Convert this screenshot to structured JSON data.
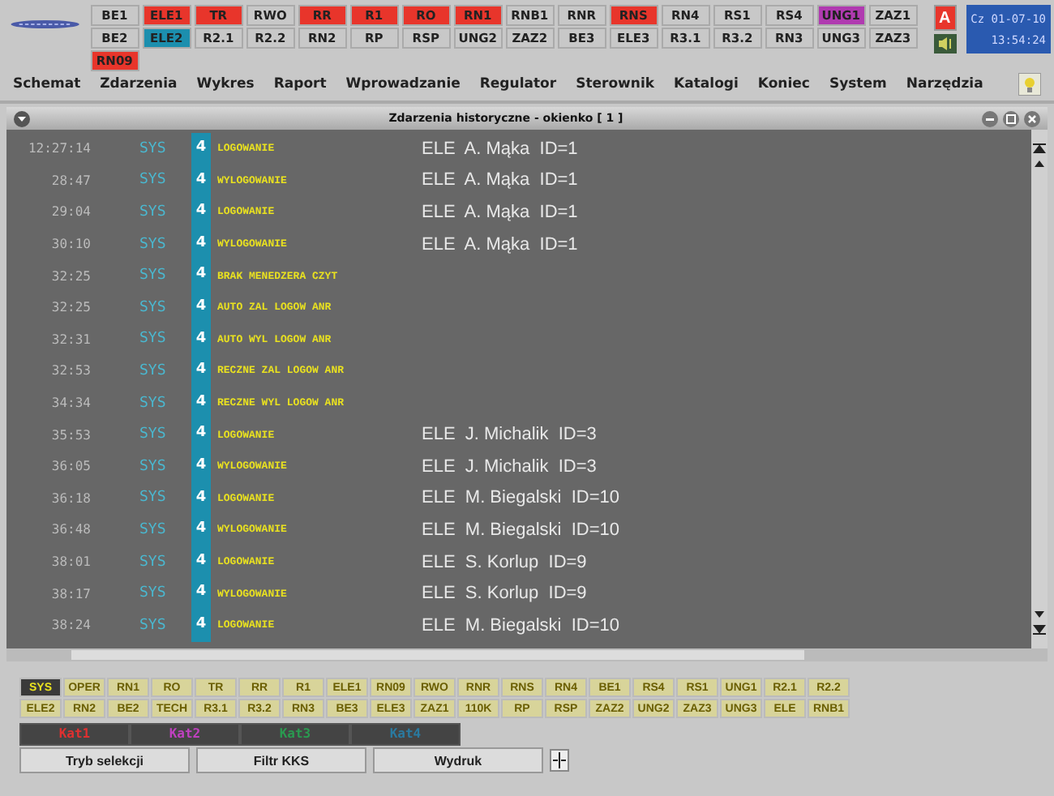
{
  "top_bar": {
    "codes": [
      [
        {
          "label": "BE1",
          "color": "#c8c8c8"
        },
        {
          "label": "BE2",
          "color": "#c8c8c8"
        },
        {
          "label": "RN09",
          "color": "#e8352b"
        }
      ],
      [
        {
          "label": "ELE1",
          "color": "#e8352b"
        },
        {
          "label": "ELE2",
          "color": "#1c8fae"
        }
      ],
      [
        {
          "label": "TR",
          "color": "#e8352b"
        },
        {
          "label": "R2.1",
          "color": "#c8c8c8"
        }
      ],
      [
        {
          "label": "RWO",
          "color": "#c8c8c8"
        },
        {
          "label": "R2.2",
          "color": "#c8c8c8"
        }
      ],
      [
        {
          "label": "RR",
          "color": "#e8352b"
        },
        {
          "label": "RN2",
          "color": "#c8c8c8"
        }
      ],
      [
        {
          "label": "R1",
          "color": "#e8352b"
        },
        {
          "label": "RP",
          "color": "#c8c8c8"
        }
      ],
      [
        {
          "label": "RO",
          "color": "#e8352b"
        },
        {
          "label": "RSP",
          "color": "#c8c8c8"
        }
      ],
      [
        {
          "label": "RN1",
          "color": "#e8352b"
        },
        {
          "label": "UNG2",
          "color": "#c8c8c8"
        }
      ],
      [
        {
          "label": "RNB1",
          "color": "#c8c8c8"
        },
        {
          "label": "ZAZ2",
          "color": "#c8c8c8"
        }
      ],
      [
        {
          "label": "RNR",
          "color": "#c8c8c8"
        },
        {
          "label": "BE3",
          "color": "#c8c8c8"
        }
      ],
      [
        {
          "label": "RNS",
          "color": "#e8352b"
        },
        {
          "label": "ELE3",
          "color": "#c8c8c8"
        }
      ],
      [
        {
          "label": "RN4",
          "color": "#c8c8c8"
        },
        {
          "label": "R3.1",
          "color": "#c8c8c8"
        }
      ],
      [
        {
          "label": "RS1",
          "color": "#c8c8c8"
        },
        {
          "label": "R3.2",
          "color": "#c8c8c8"
        }
      ],
      [
        {
          "label": "RS4",
          "color": "#c8c8c8"
        },
        {
          "label": "RN3",
          "color": "#c8c8c8"
        }
      ],
      [
        {
          "label": "UNG1",
          "color": "#b03ab0"
        },
        {
          "label": "UNG3",
          "color": "#c8c8c8"
        }
      ],
      [
        {
          "label": "ZAZ1",
          "color": "#c8c8c8"
        },
        {
          "label": "ZAZ3",
          "color": "#c8c8c8"
        }
      ]
    ],
    "alarm_button": "A",
    "date": "Cz 01-07-10",
    "time": "13:54:24"
  },
  "menu": [
    "Schemat",
    "Zdarzenia",
    "Wykres",
    "Raport",
    "Wprowadzanie",
    "Regulator",
    "Sterownik",
    "Katalogi",
    "Koniec",
    "System",
    "Narzędzia"
  ],
  "window": {
    "title": "Zdarzenia historyczne - okienko [ 1 ]"
  },
  "events": [
    {
      "time": "12:27:14",
      "source": "SYS",
      "priority": "4",
      "message": "LOGOWANIE",
      "user": "ELE  A. Mąka  ID=1"
    },
    {
      "time": "28:47",
      "source": "SYS",
      "priority": "4",
      "message": "WYLOGOWANIE",
      "user": "ELE  A. Mąka  ID=1"
    },
    {
      "time": "29:04",
      "source": "SYS",
      "priority": "4",
      "message": "LOGOWANIE",
      "user": "ELE  A. Mąka  ID=1"
    },
    {
      "time": "30:10",
      "source": "SYS",
      "priority": "4",
      "message": "WYLOGOWANIE",
      "user": "ELE  A. Mąka  ID=1"
    },
    {
      "time": "32:25",
      "source": "SYS",
      "priority": "4",
      "message": "BRAK MENEDZERA CZYT"
    },
    {
      "time": "32:25",
      "source": "SYS",
      "priority": "4",
      "message": "AUTO ZAL LOGOW ANR"
    },
    {
      "time": "32:31",
      "source": "SYS",
      "priority": "4",
      "message": "AUTO WYL LOGOW ANR"
    },
    {
      "time": "32:53",
      "source": "SYS",
      "priority": "4",
      "message": "RECZNE ZAL LOGOW ANR"
    },
    {
      "time": "34:34",
      "source": "SYS",
      "priority": "4",
      "message": "RECZNE WYL LOGOW ANR"
    },
    {
      "time": "35:53",
      "source": "SYS",
      "priority": "4",
      "message": "LOGOWANIE",
      "user": "ELE  J. Michalik  ID=3"
    },
    {
      "time": "36:05",
      "source": "SYS",
      "priority": "4",
      "message": "WYLOGOWANIE",
      "user": "ELE  J. Michalik  ID=3"
    },
    {
      "time": "36:18",
      "source": "SYS",
      "priority": "4",
      "message": "LOGOWANIE",
      "user": "ELE  M. Biegalski  ID=10"
    },
    {
      "time": "36:48",
      "source": "SYS",
      "priority": "4",
      "message": "WYLOGOWANIE",
      "user": "ELE  M. Biegalski  ID=10"
    },
    {
      "time": "38:01",
      "source": "SYS",
      "priority": "4",
      "message": "LOGOWANIE",
      "user": "ELE  S. Korlup  ID=9"
    },
    {
      "time": "38:17",
      "source": "SYS",
      "priority": "4",
      "message": "WYLOGOWANIE",
      "user": "ELE  S. Korlup  ID=9"
    },
    {
      "time": "38:24",
      "source": "SYS",
      "priority": "4",
      "message": "LOGOWANIE",
      "user": "ELE  M. Biegalski  ID=10"
    }
  ],
  "filters": [
    {
      "label": "SYS",
      "selected": true
    },
    {
      "label": "OPER",
      "selected": false
    },
    {
      "label": "RN1",
      "selected": false
    },
    {
      "label": "RO",
      "selected": false
    },
    {
      "label": "TR",
      "selected": false
    },
    {
      "label": "RR",
      "selected": false
    },
    {
      "label": "R1",
      "selected": false
    },
    {
      "label": "ELE1",
      "selected": false
    },
    {
      "label": "RN09",
      "selected": false
    },
    {
      "label": "RWO",
      "selected": false
    },
    {
      "label": "RNR",
      "selected": false
    },
    {
      "label": "RNS",
      "selected": false
    },
    {
      "label": "RN4",
      "selected": false
    },
    {
      "label": "BE1",
      "selected": false
    },
    {
      "label": "RS4",
      "selected": false
    },
    {
      "label": "RS1",
      "selected": false
    },
    {
      "label": "UNG1",
      "selected": false
    },
    {
      "label": "R2.1",
      "selected": false
    },
    {
      "label": "R2.2",
      "selected": false
    },
    {
      "label": "ELE2",
      "selected": false
    },
    {
      "label": "RN2",
      "selected": false
    },
    {
      "label": "BE2",
      "selected": false
    },
    {
      "label": "TECH",
      "selected": false
    },
    {
      "label": "R3.1",
      "selected": false
    },
    {
      "label": "R3.2",
      "selected": false
    },
    {
      "label": "RN3",
      "selected": false
    },
    {
      "label": "BE3",
      "selected": false
    },
    {
      "label": "ELE3",
      "selected": false
    },
    {
      "label": "ZAZ1",
      "selected": false
    },
    {
      "label": "110K",
      "selected": false
    },
    {
      "label": "RP",
      "selected": false
    },
    {
      "label": "RSP",
      "selected": false
    },
    {
      "label": "ZAZ2",
      "selected": false
    },
    {
      "label": "UNG2",
      "selected": false
    },
    {
      "label": "ZAZ3",
      "selected": false
    },
    {
      "label": "UNG3",
      "selected": false
    },
    {
      "label": "ELE",
      "selected": false
    },
    {
      "label": "RNB1",
      "selected": false
    }
  ],
  "categories": [
    {
      "label": "Kat1",
      "color": "#e03030"
    },
    {
      "label": "Kat2",
      "color": "#c040c0"
    },
    {
      "label": "Kat3",
      "color": "#2a9a50"
    },
    {
      "label": "Kat4",
      "color": "#2a7aa0"
    }
  ],
  "buttons": [
    "Tryb selekcji",
    "Filtr KKS",
    "Wydruk"
  ]
}
